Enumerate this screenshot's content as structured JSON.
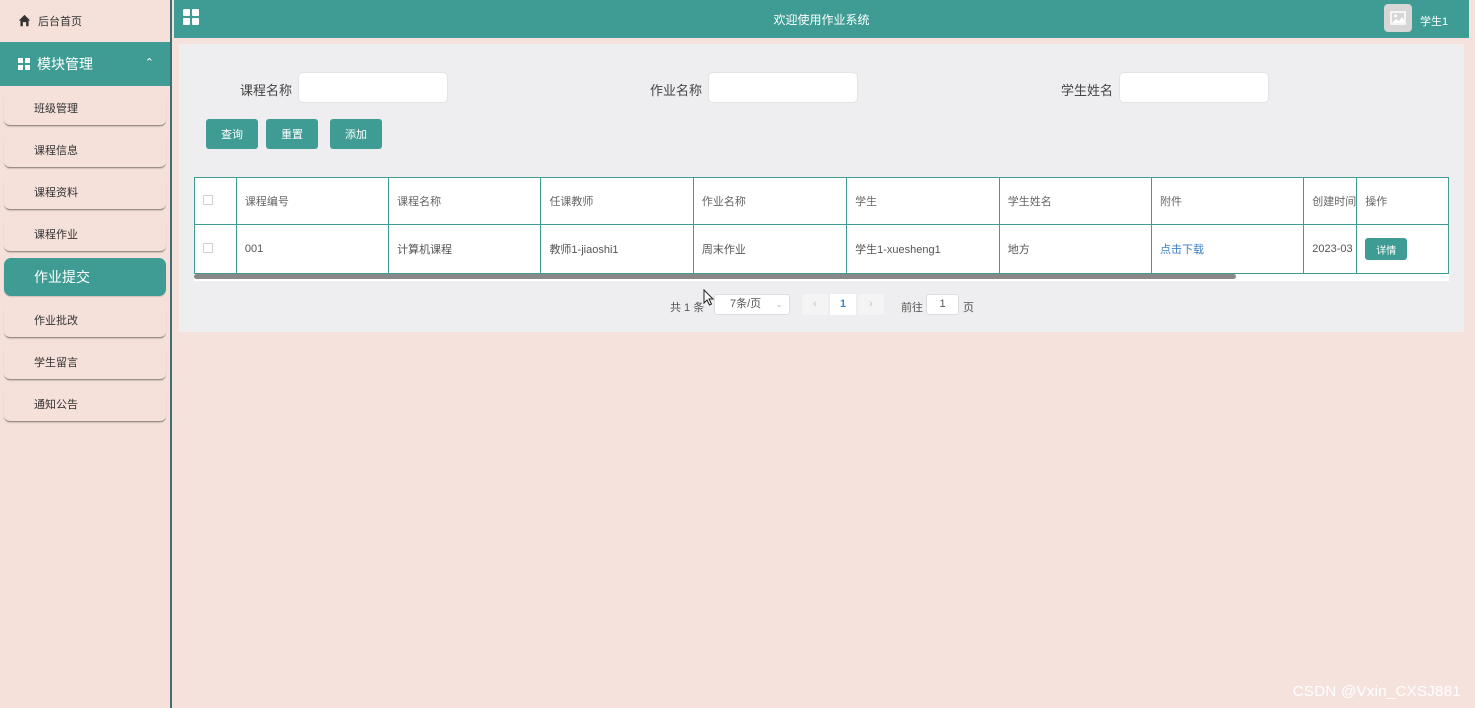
{
  "sidebar": {
    "home_label": "后台首页",
    "module_label": "模块管理",
    "items": [
      {
        "label": "班级管理"
      },
      {
        "label": "课程信息"
      },
      {
        "label": "课程资料"
      },
      {
        "label": "课程作业"
      },
      {
        "label": "作业提交",
        "active": true
      },
      {
        "label": "作业批改"
      },
      {
        "label": "学生留言"
      },
      {
        "label": "通知公告"
      }
    ]
  },
  "header": {
    "title": "欢迎使用作业系统",
    "username": "学生1"
  },
  "search": {
    "course_name_label": "课程名称",
    "homework_name_label": "作业名称",
    "student_name_label": "学生姓名",
    "course_name_value": "",
    "homework_name_value": "",
    "student_name_value": ""
  },
  "buttons": {
    "query": "查询",
    "reset": "重置",
    "add": "添加"
  },
  "table": {
    "columns": [
      "课程编号",
      "课程名称",
      "任课教师",
      "作业名称",
      "学生",
      "学生姓名",
      "附件",
      "创建时间",
      "操作"
    ],
    "rows": [
      {
        "course_id": "001",
        "course_name": "计算机课程",
        "teacher": "教师1-jiaoshi1",
        "homework_name": "周末作业",
        "student": "学生1-xuesheng1",
        "student_name": "地方",
        "attachment": "点击下载",
        "created": "2023-03",
        "action": "详情"
      }
    ]
  },
  "pagination": {
    "total_text": "共 1 条",
    "page_size": "7条/页",
    "prev": "‹",
    "current_page": "1",
    "next": "›",
    "goto_label": "前往",
    "goto_value": "1",
    "goto_suffix": "页"
  },
  "watermark": "CSDN @Vxin_CXSJ881",
  "colors": {
    "accent": "#3f9c94",
    "background": "#f6e2dc",
    "panel": "#eeedef",
    "link": "#3b82c4"
  }
}
